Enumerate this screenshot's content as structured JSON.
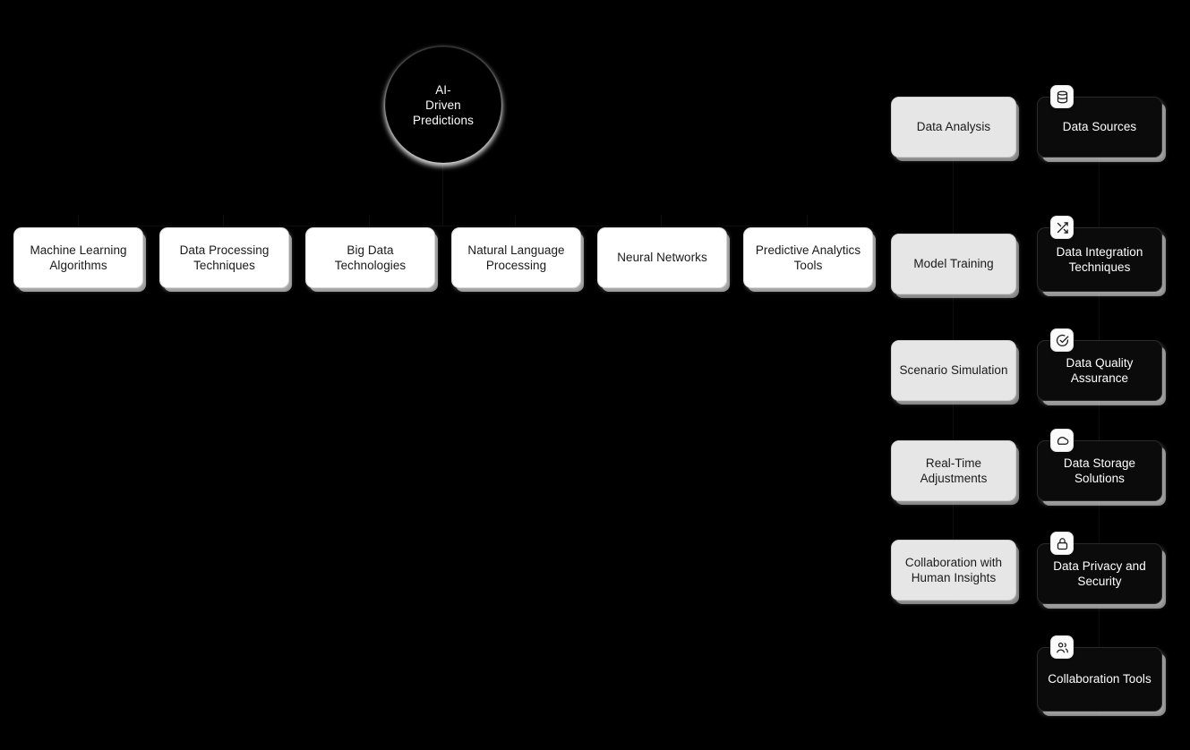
{
  "diagram": {
    "title": "AI-Driven Predictions mind map",
    "background_color": "#000000",
    "hub": {
      "label": "AI-\nDriven\nPredictions",
      "line1": "AI-",
      "line2": "Driven",
      "line3": "Predictions",
      "shape": "circle",
      "fill": "#000000",
      "text_color": "#ffffff"
    },
    "branch_row": {
      "style": "white-box",
      "fill": "#ffffff",
      "text_color": "#1a1a1a",
      "items": [
        {
          "label": "Machine Learning Algorithms"
        },
        {
          "label": "Data Processing Techniques"
        },
        {
          "label": "Big Data Technologies"
        },
        {
          "label": "Natural Language Processing"
        },
        {
          "label": "Neural Networks"
        },
        {
          "label": "Predictive Analytics Tools"
        }
      ]
    },
    "middle_column": {
      "style": "grey-box",
      "fill": "#e6e6e6",
      "text_color": "#1a1a1a",
      "items": [
        {
          "label": "Data Analysis"
        },
        {
          "label": "Model Training"
        },
        {
          "label": "Scenario Simulation"
        },
        {
          "label": "Real-Time Adjustments"
        },
        {
          "label": "Collaboration with Human Insights"
        }
      ]
    },
    "right_column": {
      "style": "dark-box",
      "fill": "#0b0b0b",
      "text_color": "#ffffff",
      "items": [
        {
          "label": "Data Sources",
          "icon": "database-icon"
        },
        {
          "label": "Data Integration Techniques",
          "icon": "shuffle-icon"
        },
        {
          "label": "Data Quality Assurance",
          "icon": "check-circle-icon"
        },
        {
          "label": "Data Storage Solutions",
          "icon": "cloud-icon"
        },
        {
          "label": "Data Privacy and Security",
          "icon": "lock-icon"
        },
        {
          "label": "Collaboration Tools",
          "icon": "users-icon"
        }
      ]
    }
  }
}
